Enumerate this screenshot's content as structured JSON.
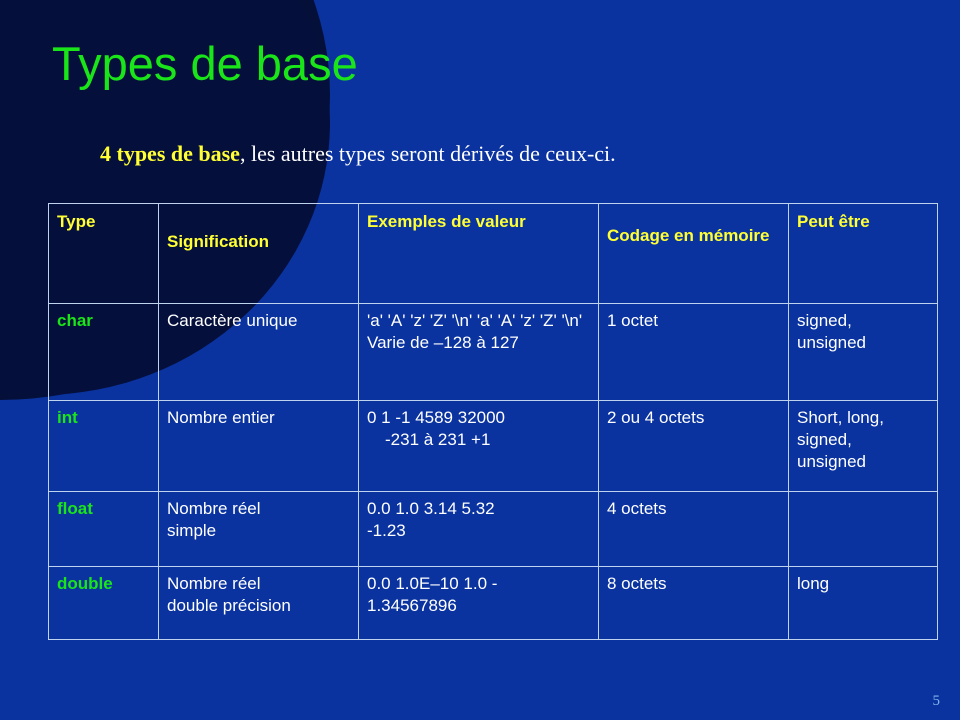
{
  "slide": {
    "title": "Types de base",
    "page_number": "5",
    "colors": {
      "background": "#0A33A0",
      "decor_shape": "#051142",
      "title_green": "#19E519",
      "highlight_yellow": "#FFFF33",
      "body_white": "#FFFFFF",
      "table_border": "#BFD2EE",
      "page_number": "#7FB5E8"
    }
  },
  "subtitle": {
    "highlight": "4 types de base",
    "rest": ", les autres types seront dérivés de ceux-ci."
  },
  "table": {
    "headers": [
      "Type",
      "Signification",
      "Exemples de valeur",
      "Codage en mémoire",
      "Peut être"
    ],
    "rows": [
      {
        "type": "char",
        "signification": "Caractère unique",
        "examples_line1": "'a' 'A' 'z' 'Z' '\\n' 'a' 'A' 'z' 'Z' '\\n'",
        "examples_line2": "Varie de –128 à 127",
        "codage": "1 octet",
        "peut_etre_line1": "signed,",
        "peut_etre_line2": "unsigned"
      },
      {
        "type": "int",
        "signification": "Nombre entier",
        "examples_line1": "0 1 -1  4589  32000",
        "examples_line2": "-231 à 231 +1",
        "codage": "2 ou 4 octets",
        "peut_etre_line1": "Short, long,",
        "peut_etre_line2": "signed,",
        "peut_etre_line3": "unsigned"
      },
      {
        "type": "float",
        "signification_line1": "Nombre réel",
        "signification_line2": "simple",
        "examples_line1": "0.0  1.0  3.14  5.32",
        "examples_line2": "-1.23",
        "codage": "4 octets",
        "peut_etre": ""
      },
      {
        "type": "double",
        "signification_line1": "Nombre réel",
        "signification_line2": "double précision",
        "examples_line1": "0.0 1.0E–10   1.0    -",
        "examples_line2": "1.34567896",
        "codage": "8 octets",
        "peut_etre": "long"
      }
    ]
  }
}
